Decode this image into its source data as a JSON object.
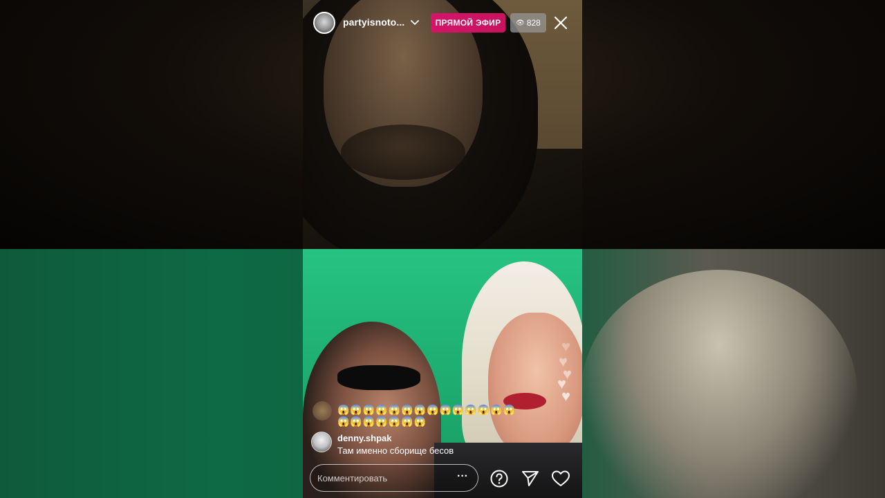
{
  "topbar": {
    "username": "partyisnoto...",
    "live_label": "ПРЯМОЙ ЭФИР",
    "viewer_count": "828",
    "avatar_icon": "user-avatar",
    "chevron_icon": "chevron-down-icon",
    "eye_icon": "eye-icon",
    "close_icon": "close-icon"
  },
  "reactions": {
    "emoji_row_1": "😱😱😱😱😱😱😱😱😱😱😱😱😱😱",
    "emoji_row_2": "😱😱😱😱😱😱😱"
  },
  "comment": {
    "username": "denny.shpak",
    "text": "Там именно сборище бесов"
  },
  "input": {
    "placeholder": "Комментировать",
    "more_icon": "more-horizontal-icon"
  },
  "actions": {
    "question_icon": "question-icon",
    "share_icon": "send-icon",
    "like_icon": "heart-icon"
  },
  "colors": {
    "live_badge": "#d3146a",
    "viewer_badge": "#969696"
  }
}
